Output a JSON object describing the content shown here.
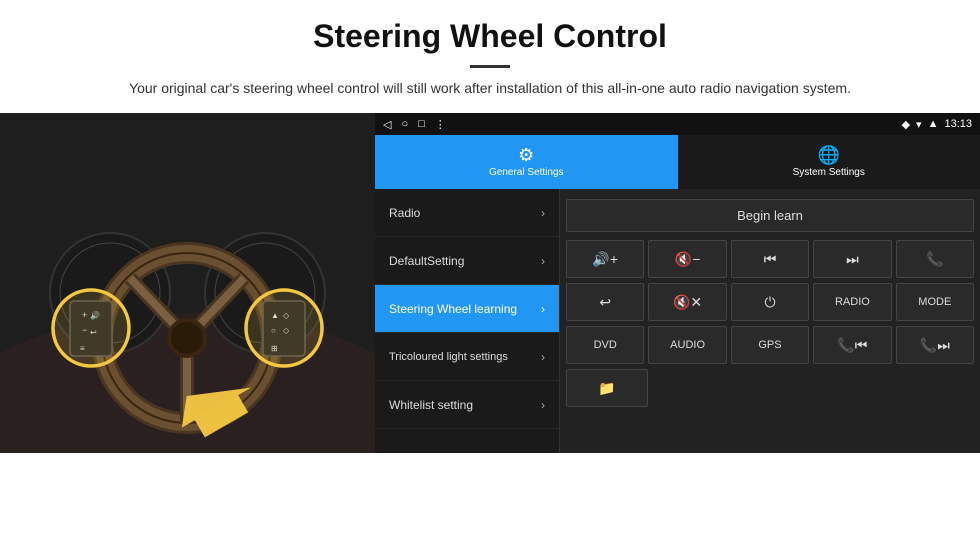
{
  "header": {
    "title": "Steering Wheel Control",
    "subtitle": "Your original car's steering wheel control will still work after installation of this all-in-one auto radio navigation system."
  },
  "status_bar": {
    "back": "◁",
    "home": "○",
    "square": "□",
    "dots": "⋮",
    "location": "♦",
    "wifi": "▾",
    "signal": "▲",
    "time": "13:13"
  },
  "tabs": [
    {
      "id": "general",
      "icon": "⚙",
      "label": "General Settings",
      "active": true
    },
    {
      "id": "system",
      "icon": "🌐",
      "label": "System Settings",
      "active": false
    }
  ],
  "menu_items": [
    {
      "id": "radio",
      "label": "Radio",
      "active": false
    },
    {
      "id": "default",
      "label": "DefaultSetting",
      "active": false
    },
    {
      "id": "steering",
      "label": "Steering Wheel learning",
      "active": true
    },
    {
      "id": "tricoloured",
      "label": "Tricoloured light settings",
      "active": false
    },
    {
      "id": "whitelist",
      "label": "Whitelist setting",
      "active": false
    }
  ],
  "right_panel": {
    "begin_learn": "Begin learn",
    "buttons_row1": [
      {
        "id": "vol_up",
        "label": "🔊+",
        "type": "icon"
      },
      {
        "id": "vol_down",
        "label": "🔇-",
        "type": "icon"
      },
      {
        "id": "prev",
        "label": "⏮",
        "type": "icon"
      },
      {
        "id": "next",
        "label": "⏭",
        "type": "icon"
      },
      {
        "id": "phone",
        "label": "📞",
        "type": "icon"
      }
    ],
    "buttons_row2": [
      {
        "id": "hook",
        "label": "↩",
        "type": "icon"
      },
      {
        "id": "mute",
        "label": "🔇×",
        "type": "icon"
      },
      {
        "id": "power",
        "label": "⏻",
        "type": "icon"
      },
      {
        "id": "radio_btn",
        "label": "RADIO",
        "type": "text"
      },
      {
        "id": "mode_btn",
        "label": "MODE",
        "type": "text"
      }
    ],
    "buttons_row3": [
      {
        "id": "dvd",
        "label": "DVD",
        "type": "text"
      },
      {
        "id": "audio",
        "label": "AUDIO",
        "type": "text"
      },
      {
        "id": "gps",
        "label": "GPS",
        "type": "text"
      },
      {
        "id": "tel_prev",
        "label": "📞⏮",
        "type": "icon"
      },
      {
        "id": "tel_next",
        "label": "📞⏭",
        "type": "icon"
      }
    ],
    "buttons_row4": [
      {
        "id": "file_icon",
        "label": "📁",
        "type": "icon"
      }
    ]
  }
}
